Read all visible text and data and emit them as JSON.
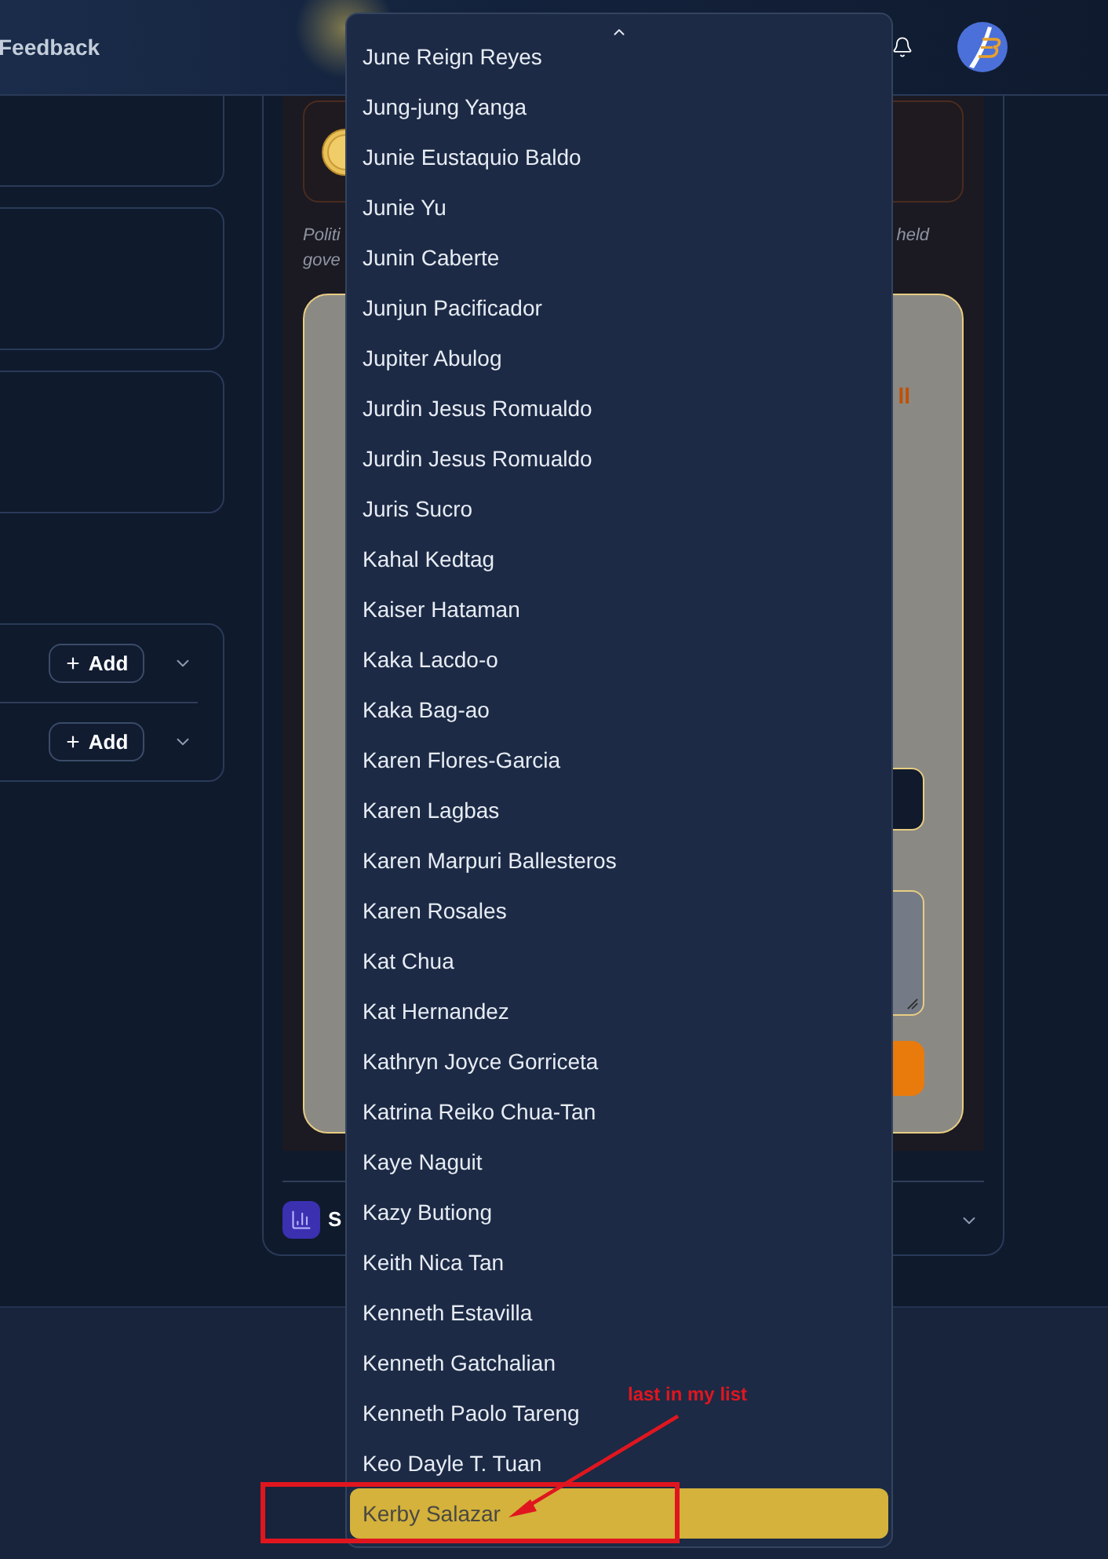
{
  "header": {
    "nav_link": "Feedback"
  },
  "left_panel": {
    "sections": [
      {
        "add_button": "Add",
        "expanded": false
      },
      {
        "add_button": "Add",
        "expanded": false
      }
    ]
  },
  "detail_panel": {
    "note_left": [
      "Politi",
      "gove"
    ],
    "note_right": "held",
    "form_text_fragment": "ll",
    "section": {
      "title": "S",
      "expanded": false
    }
  },
  "dropdown": {
    "options": [
      {
        "label": "June Reign Reyes",
        "selected": false
      },
      {
        "label": "Jung-jung Yanga",
        "selected": false
      },
      {
        "label": "Junie Eustaquio Baldo",
        "selected": false
      },
      {
        "label": "Junie Yu",
        "selected": false
      },
      {
        "label": "Junin Caberte",
        "selected": false
      },
      {
        "label": "Junjun Pacificador",
        "selected": false
      },
      {
        "label": "Jupiter Abulog",
        "selected": false
      },
      {
        "label": "Jurdin Jesus Romualdo",
        "selected": false
      },
      {
        "label": "Jurdin Jesus Romualdo",
        "selected": false
      },
      {
        "label": "Juris Sucro",
        "selected": false
      },
      {
        "label": "Kahal Kedtag",
        "selected": false
      },
      {
        "label": "Kaiser Hataman",
        "selected": false
      },
      {
        "label": "Kaka Lacdo-o",
        "selected": false
      },
      {
        "label": "Kaka Bag-ao",
        "selected": false
      },
      {
        "label": "Karen Flores-Garcia",
        "selected": false
      },
      {
        "label": "Karen Lagbas",
        "selected": false
      },
      {
        "label": "Karen Marpuri Ballesteros",
        "selected": false
      },
      {
        "label": "Karen Rosales",
        "selected": false
      },
      {
        "label": "Kat Chua",
        "selected": false
      },
      {
        "label": "Kat Hernandez",
        "selected": false
      },
      {
        "label": "Kathryn Joyce Gorriceta",
        "selected": false
      },
      {
        "label": "Katrina Reiko Chua-Tan",
        "selected": false
      },
      {
        "label": "Kaye Naguit",
        "selected": false
      },
      {
        "label": "Kazy Butiong",
        "selected": false
      },
      {
        "label": "Keith Nica Tan",
        "selected": false
      },
      {
        "label": "Kenneth Estavilla",
        "selected": false
      },
      {
        "label": "Kenneth Gatchalian",
        "selected": false
      },
      {
        "label": "Kenneth Paolo Tareng",
        "selected": false
      },
      {
        "label": "Keo Dayle T. Tuan",
        "selected": false
      },
      {
        "label": "Kerby Salazar",
        "selected": true
      }
    ]
  },
  "annotation": {
    "text": "last in my list"
  }
}
